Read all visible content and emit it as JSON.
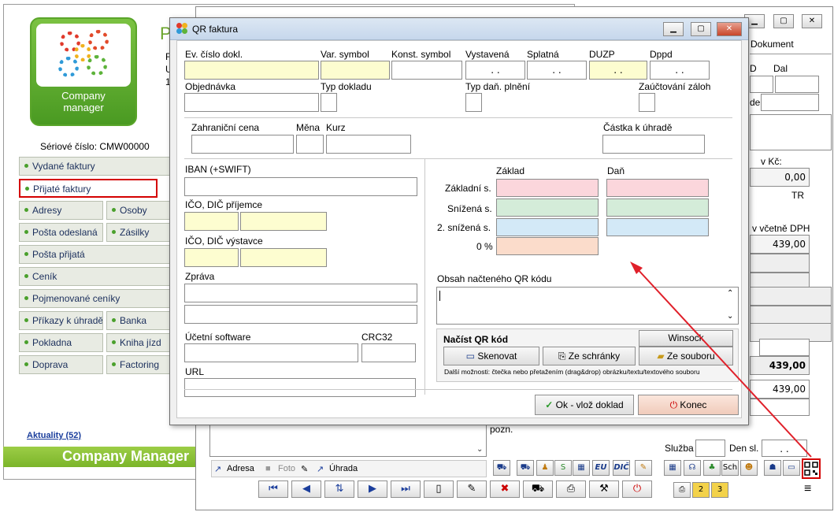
{
  "back_window": {
    "logo_text": "Company\nmanager",
    "title_partial": "P",
    "side_letters": [
      "F",
      "U",
      "1"
    ],
    "serial": "Sériové číslo: CMW00000",
    "nav_items": [
      {
        "label": "Vydané faktury"
      },
      {
        "label": "Přijaté faktury"
      },
      {
        "label": "Adresy"
      },
      {
        "label": "Osoby"
      },
      {
        "label": "Pošta odeslaná"
      },
      {
        "label": "Zásilky"
      },
      {
        "label": "Pošta přijatá"
      },
      {
        "label": "Ceník"
      },
      {
        "label": "Pojmenované ceníky"
      },
      {
        "label": "Příkazy k úhradě"
      },
      {
        "label": "Banka"
      },
      {
        "label": "Pokladna"
      },
      {
        "label": "Kniha jízd"
      },
      {
        "label": "Doprava"
      },
      {
        "label": "Factoring"
      }
    ],
    "news_link": "Aktuality (52)",
    "brand_bar": "Company Manager"
  },
  "mid_window": {
    "tab_dokument": "Dokument",
    "col_d": "D",
    "col_dal": "Dal",
    "lbl_de": "de",
    "lbl_v_kc": "v Kč:",
    "val_000": "0,00",
    "val_tr": "TR",
    "lbl_vcetne_dph": "v včetně DPH",
    "val_439_1": "439,00",
    "val_439_bold": "439,00",
    "val_439_2": "439,00",
    "lbl_pozn": "pozn.",
    "lbl_sluzba": "Služba",
    "lbl_den_sl": "Den sl.",
    "den_sl_value": ". .",
    "link_adresa": "Adresa",
    "link_foto": "Foto",
    "link_uhrada": "Úhrada",
    "btn_sch": "Sch",
    "btn_eu": "EU",
    "btn_dic": "DIČ"
  },
  "dialog": {
    "title": "QR faktura",
    "labels": {
      "ev_cislo": "Ev. číslo dokl.",
      "var_symbol": "Var. symbol",
      "konst_symbol": "Konst. symbol",
      "vystavena": "Vystavená",
      "splatna": "Splatná",
      "duzp": "DUZP",
      "dppd": "Dppd",
      "objednavka": "Objednávka",
      "typ_dokladu": "Typ dokladu",
      "typ_dan_plneni": "Typ daň. plnění",
      "zauctovani_zaloh": "Zaúčtování záloh",
      "zahranicni_cena": "Zahraniční cena",
      "mena": "Měna",
      "kurz": "Kurz",
      "castka_k_uhrade": "Částka k úhradě",
      "iban": "IBAN (+SWIFT)",
      "ico_dic_prijemce": "IČO, DIČ příjemce",
      "ico_dic_vystavce": "IČO, DIČ výstavce",
      "zprava": "Zpráva",
      "ucetni_software": "Účetní software",
      "crc32": "CRC32",
      "url": "URL",
      "zaklad": "Základ",
      "dan": "Daň",
      "zakladni_s": "Základní s.",
      "snizena_s": "Snížená s.",
      "druha_snizena_s": "2. snížená s.",
      "nula_procent": "0 %",
      "obsah_qr": "Obsah načteného QR kódu",
      "nacist_qr": "Načíst QR kód"
    },
    "values": {
      "vystavena": ". .",
      "splatna": ". .",
      "duzp": ". .",
      "dppd": ". ."
    },
    "buttons": {
      "winsock": "Winsock",
      "skenovat": "Skenovat",
      "ze_schranky": "Ze schránky",
      "ze_souboru": "Ze souboru",
      "ok": "Ok - vlož doklad",
      "konec": "Konec"
    },
    "hint": "Další možnosti: čtečka nebo přetažením (drag&drop) obrázku/textu/textového souboru"
  },
  "colors": {
    "brand_green": "#7bb52a",
    "field_yellow": "#fdfdd0",
    "arrow_red": "#e0202a",
    "highlight_red": "#d40000"
  }
}
